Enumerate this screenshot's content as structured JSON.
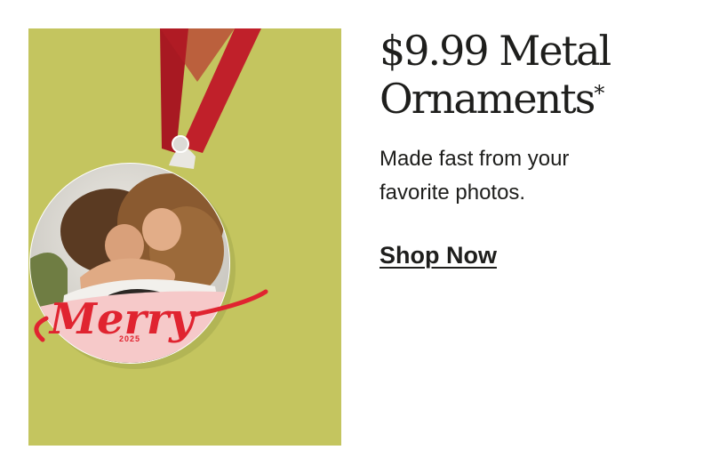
{
  "promo": {
    "headline_line1": "$9.99 Metal",
    "headline_line2": "Ornaments",
    "headline_asterisk": "*",
    "subtext": "Made fast from your favorite photos.",
    "cta_label": "Shop Now"
  },
  "ornament": {
    "script_text": "Merry",
    "year": "2025"
  },
  "colors": {
    "panel_background": "#c4c55f",
    "ribbon": "#c0202a",
    "ornament_accent": "#e02430",
    "ornament_pink": "#f6c9c9",
    "text": "#1e1e1c"
  }
}
